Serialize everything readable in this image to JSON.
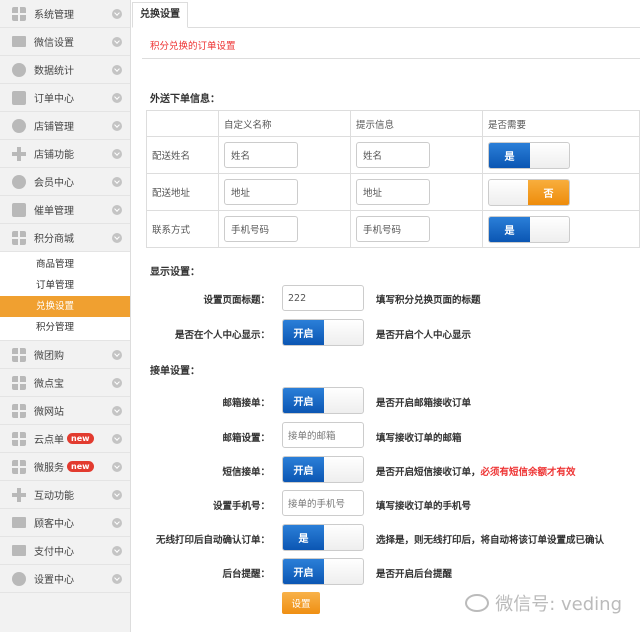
{
  "sidebar": {
    "items": [
      {
        "label": "系统管理",
        "icon": "grid-icon"
      },
      {
        "label": "微信设置",
        "icon": "mail-icon"
      },
      {
        "label": "数据统计",
        "icon": "pie-chart-icon"
      },
      {
        "label": "订单中心",
        "icon": "cart-icon"
      },
      {
        "label": "店铺管理",
        "icon": "clock-icon"
      },
      {
        "label": "店铺功能",
        "icon": "plus-icon"
      },
      {
        "label": "会员中心",
        "icon": "user-icon"
      },
      {
        "label": "催单管理",
        "icon": "printer-icon"
      },
      {
        "label": "积分商城",
        "icon": "grid-icon"
      }
    ],
    "sub_items": [
      {
        "label": "商品管理"
      },
      {
        "label": "订单管理"
      },
      {
        "label": "兑换设置"
      },
      {
        "label": "积分管理"
      }
    ],
    "items_after": [
      {
        "label": "微团购",
        "icon": "grid-icon"
      },
      {
        "label": "微点宝",
        "icon": "grid-icon"
      },
      {
        "label": "微网站",
        "icon": "grid-icon"
      },
      {
        "label": "云点单",
        "icon": "grid-icon",
        "badge": "new"
      },
      {
        "label": "微服务",
        "icon": "grid-icon",
        "badge": "new"
      },
      {
        "label": "互动功能",
        "icon": "plus-icon"
      },
      {
        "label": "顾客中心",
        "icon": "inbox-icon"
      },
      {
        "label": "支付中心",
        "icon": "inbox-icon"
      },
      {
        "label": "设置中心",
        "icon": "gear-icon"
      }
    ]
  },
  "main": {
    "tab": "兑换设置",
    "subtitle": "积分兑换的订单设置",
    "delivery_title": "外送下单信息：",
    "table_headers": [
      "自定义名称",
      "提示信息",
      "是否需要"
    ],
    "table_rows": [
      {
        "label": "配送姓名",
        "name": "姓名",
        "hint": "姓名",
        "toggle": "是",
        "state": "on"
      },
      {
        "label": "配送地址",
        "name": "地址",
        "hint": "地址",
        "toggle": "否",
        "state": "off"
      },
      {
        "label": "联系方式",
        "name": "手机号码",
        "hint": "手机号码",
        "toggle": "是",
        "state": "on"
      }
    ],
    "display_title": "显示设置：",
    "page_title_label": "设置页面标题：",
    "page_title_value": "222",
    "page_title_help": "填写积分兑换页面的标题",
    "show_in_center_label": "是否在个人中心显示：",
    "show_in_center_toggle": "开启",
    "show_in_center_help": "是否开启个人中心显示",
    "order_title": "接单设置：",
    "email_label": "邮箱接单：",
    "email_toggle": "开启",
    "email_help": "是否开启邮箱接收订单",
    "email_setting_label": "邮箱设置：",
    "email_setting_placeholder": "接单的邮箱",
    "email_setting_help": "填写接收订单的邮箱",
    "sms_label": "短信接单：",
    "sms_toggle": "开启",
    "sms_help": "是否开启短信接收订单，",
    "sms_help_red": "必须有短信余额才有效",
    "phone_label": "设置手机号：",
    "phone_placeholder": "接单的手机号",
    "phone_help": "填写接收订单的手机号",
    "wireless_label": "无线打印后自动确认订单：",
    "wireless_toggle": "是",
    "wireless_help": "选择是，则无线打印后，将自动将该订单设置成已确认",
    "backend_label": "后台提醒：",
    "backend_toggle": "开启",
    "backend_help": "是否开启后台提醒",
    "submit": "设置"
  },
  "watermark": "微信号: veding"
}
